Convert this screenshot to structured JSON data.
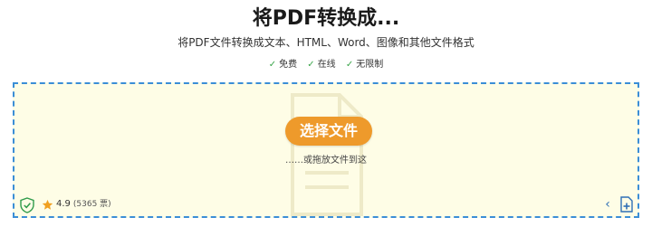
{
  "header": {
    "title": "将PDF转换成...",
    "subtitle": "将PDF文件转换成文本、HTML、Word、图像和其他文件格式"
  },
  "features": [
    {
      "label": "免费",
      "icon": "check-icon"
    },
    {
      "label": "在线",
      "icon": "check-icon"
    },
    {
      "label": "无限制",
      "icon": "check-icon"
    }
  ],
  "dropzone": {
    "choose_label": "选择文件",
    "drop_hint": "……或拖放文件到这",
    "rating_value": "4.9",
    "votes": "(5365 票)",
    "colors": {
      "background": "#fefde6",
      "border": "#3b8ed6",
      "button": "#ee9a2b",
      "check": "#3aa54a"
    }
  }
}
